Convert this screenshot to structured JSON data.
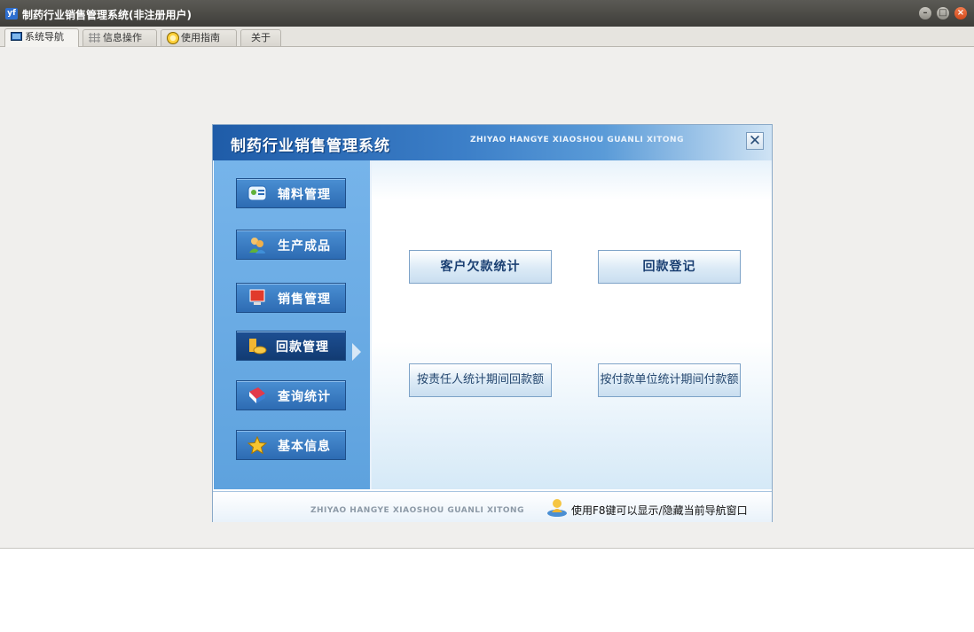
{
  "window": {
    "title": "制药行业销售管理系统(非注册用户)",
    "logo_text": "yf",
    "controls": [
      "minimize",
      "maximize",
      "close"
    ]
  },
  "tabs": [
    {
      "label": "系统导航",
      "icon": "monitor-icon",
      "active": true
    },
    {
      "label": "信息操作",
      "icon": "grid-icon",
      "active": false
    },
    {
      "label": "使用指南",
      "icon": "help-circle-icon",
      "active": false
    },
    {
      "label": "关于",
      "icon": "",
      "active": false
    }
  ],
  "dialog": {
    "title": "制药行业销售管理系统",
    "subtitle": "ZHIYAO HANGYE XIAOSHOU GUANLI XITONG",
    "close_glyph": "✕",
    "sidebar": [
      {
        "label": "辅料管理",
        "icon": "materials-icon"
      },
      {
        "label": "生产成品",
        "icon": "users-icon"
      },
      {
        "label": "销售管理",
        "icon": "monitor-icon"
      },
      {
        "label": "回款管理",
        "icon": "coins-icon",
        "active": true
      },
      {
        "label": "查询统计",
        "icon": "book-icon"
      },
      {
        "label": "基本信息",
        "icon": "star-icon"
      }
    ],
    "actions": [
      {
        "label": "客户欠款统计"
      },
      {
        "label": "回款登记"
      },
      {
        "label": "按责任人统计期间回款额"
      },
      {
        "label": "按付款单位统计期间付款额"
      }
    ],
    "footer": {
      "subtitle": "ZHIYAO HANGYE XIAOSHOU GUANLI XITONG",
      "hint": "使用F8键可以显示/隐藏当前导航窗口"
    }
  },
  "colors": {
    "titlebar": "#3e3d39",
    "header_blue": "#1f5ca8",
    "sidebar_blue": "#5ea2de",
    "active_item": "#123b72"
  }
}
